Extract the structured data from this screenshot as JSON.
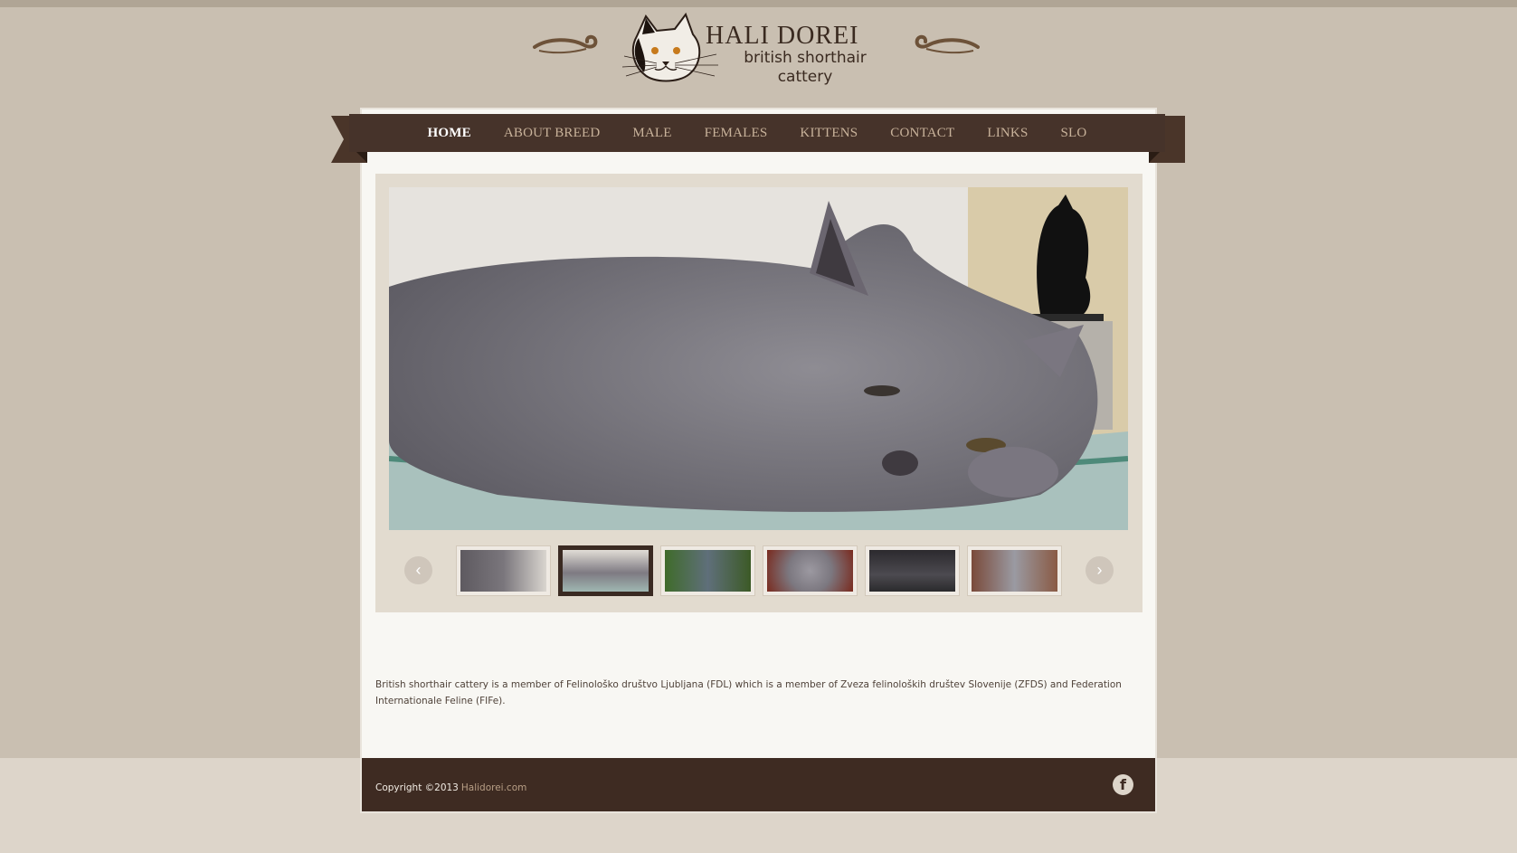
{
  "brand": {
    "name": "HALI DOREI",
    "tagline_line1": "british shorthair",
    "tagline_line2": "cattery"
  },
  "nav": {
    "items": [
      {
        "label": "HOME",
        "active": true
      },
      {
        "label": "ABOUT BREED",
        "active": false
      },
      {
        "label": "MALE",
        "active": false
      },
      {
        "label": "FEMALES",
        "active": false
      },
      {
        "label": "KITTENS",
        "active": false
      },
      {
        "label": "CONTACT",
        "active": false
      },
      {
        "label": "LINKS",
        "active": false
      },
      {
        "label": "SLO",
        "active": false
      }
    ]
  },
  "slider": {
    "prev_icon": "chevron-left-icon",
    "next_icon": "chevron-right-icon",
    "active_thumb": 2,
    "thumb_count": 6
  },
  "content": {
    "intro": "British shorthair cattery is a member of Felinološko društvo Ljubljana (FDL) which is a member of Zveza felinoloških društev Slovenije (ZFDS) and Federation Internationale Feline (FIFe)."
  },
  "footer": {
    "copyright": "Copyright ©2013",
    "site_link": "Halidorei.com",
    "social_icon": "facebook-icon"
  },
  "colors": {
    "page_bg": "#c9bfb1",
    "nav_bg": "#46332a",
    "nav_text": "#c8b29a",
    "footer_bg": "#3e2b22",
    "slider_bg": "#e2dbcf"
  }
}
